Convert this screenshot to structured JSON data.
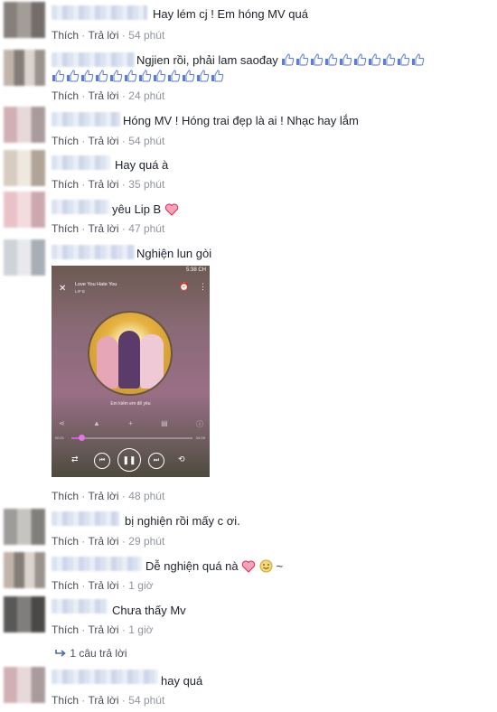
{
  "actions": {
    "like": "Thích",
    "reply": "Trả lời",
    "dot": "·"
  },
  "comments": [
    {
      "text": "Hay lém cj ! Em hóng MV quá",
      "time": "54 phút"
    },
    {
      "text": "Ngjien rồi, phải lam saođay",
      "time": "24 phút"
    },
    {
      "text": "Hóng MV ! Hóng trai đẹp là ai ! Nhạc hay lắm",
      "time": "54 phút"
    },
    {
      "text": "Hay quá à",
      "time": "35 phút"
    },
    {
      "text": "yêu Lip B",
      "time": "47 phút"
    },
    {
      "text": "Nghiện lun gòi",
      "time": "48 phút"
    },
    {
      "text": "bị nghiện rồi mấy c ơi.",
      "time": "29 phút"
    },
    {
      "text": "Dễ nghiện quá nà",
      "tail": "~",
      "time": "1 giờ"
    },
    {
      "text": "Chưa thấy Mv",
      "time": "1 giờ"
    },
    {
      "text": "hay quá",
      "time": "54 phút"
    }
  ],
  "reply_count": "1 câu trả lời",
  "phone": {
    "status_time": "5:38 CH",
    "song_title": "Love You Hate You",
    "artist": "LIP B",
    "lyric": "Em kiếm em để yêu",
    "time_elapsed": "00:21",
    "time_total": "04:09",
    "progress": 0.08
  },
  "icons": {
    "like": "thumbs-up-icon",
    "heart": "heart-icon",
    "emoji": "smile-icon",
    "reply_arrow": "reply-arrow-icon"
  },
  "colors": {
    "link": "#4b4f56",
    "meta": "#90949c",
    "like_blue": "#5b7bd5",
    "heart": "#e0245e"
  }
}
